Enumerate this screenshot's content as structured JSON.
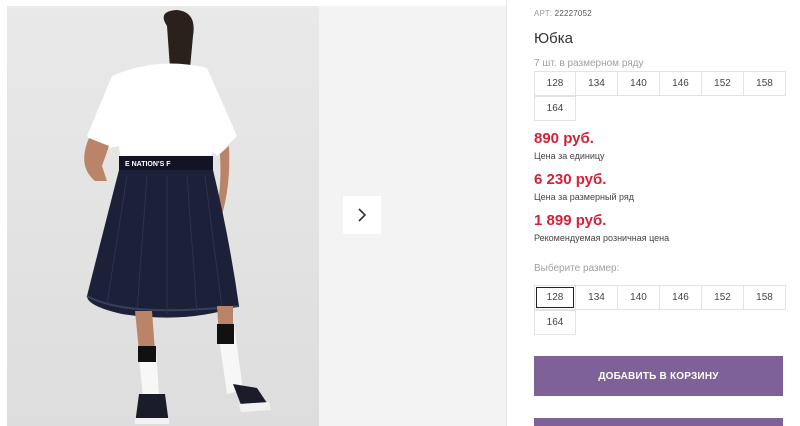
{
  "product": {
    "art_prefix": "АРТ:",
    "art_code": "22227052",
    "title": "Юбка"
  },
  "series": {
    "note": "7 шт. в размерном ряду",
    "sizes": [
      "128",
      "134",
      "140",
      "146",
      "152",
      "158",
      "164"
    ]
  },
  "prices": [
    {
      "value": "890 руб.",
      "label": "Цена за единицу"
    },
    {
      "value": "6 230 руб.",
      "label": "Цена за размерный ряд"
    },
    {
      "value": "1 899 руб.",
      "label": "Рекомендуемая розничная цена"
    }
  ],
  "choose": {
    "label": "Выберите размер:",
    "sizes": [
      "128",
      "134",
      "140",
      "146",
      "152",
      "158",
      "164"
    ],
    "selected": "128"
  },
  "buttons": {
    "add_to_cart": "Добавить в корзину"
  },
  "gallery": {
    "next_icon": "chevron-right-icon"
  },
  "colors": {
    "accent": "#7e6197",
    "price": "#d4213a"
  }
}
